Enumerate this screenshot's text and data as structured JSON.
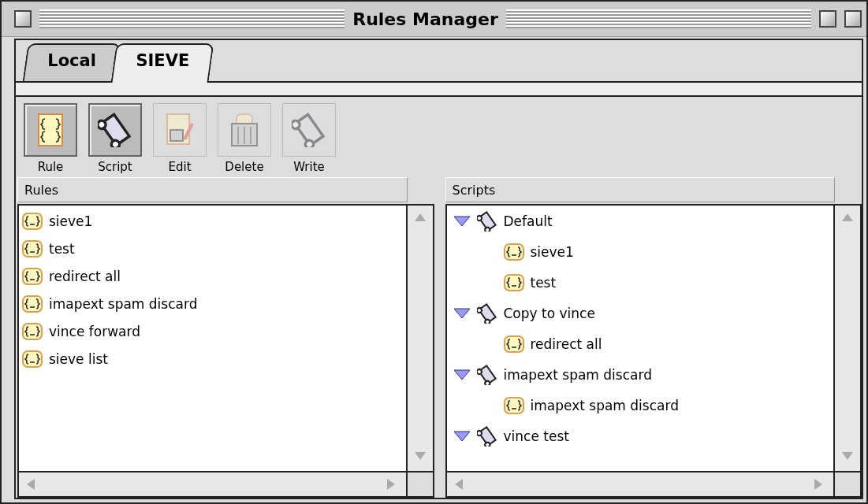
{
  "window": {
    "title": "Rules Manager"
  },
  "tabs": [
    {
      "label": "Local",
      "selected": false
    },
    {
      "label": "SIEVE",
      "selected": true
    }
  ],
  "toolbar": [
    {
      "label": "Rule",
      "disabled": false
    },
    {
      "label": "Script",
      "disabled": false
    },
    {
      "label": "Edit",
      "disabled": true
    },
    {
      "label": "Delete",
      "disabled": true
    },
    {
      "label": "Write",
      "disabled": true
    }
  ],
  "rules": {
    "header": "Rules",
    "items": [
      "sieve1",
      "test",
      "redirect all",
      "imapext spam discard",
      "vince forward",
      "sieve list"
    ]
  },
  "scripts": {
    "header": "Scripts",
    "items": [
      {
        "label": "Default",
        "expanded": true,
        "children": [
          "sieve1",
          "test"
        ]
      },
      {
        "label": "Copy to vince",
        "expanded": true,
        "children": [
          "redirect all"
        ]
      },
      {
        "label": "imapext spam discard",
        "expanded": true,
        "children": [
          "imapext spam discard"
        ]
      },
      {
        "label": "vince test",
        "expanded": true
      }
    ]
  }
}
